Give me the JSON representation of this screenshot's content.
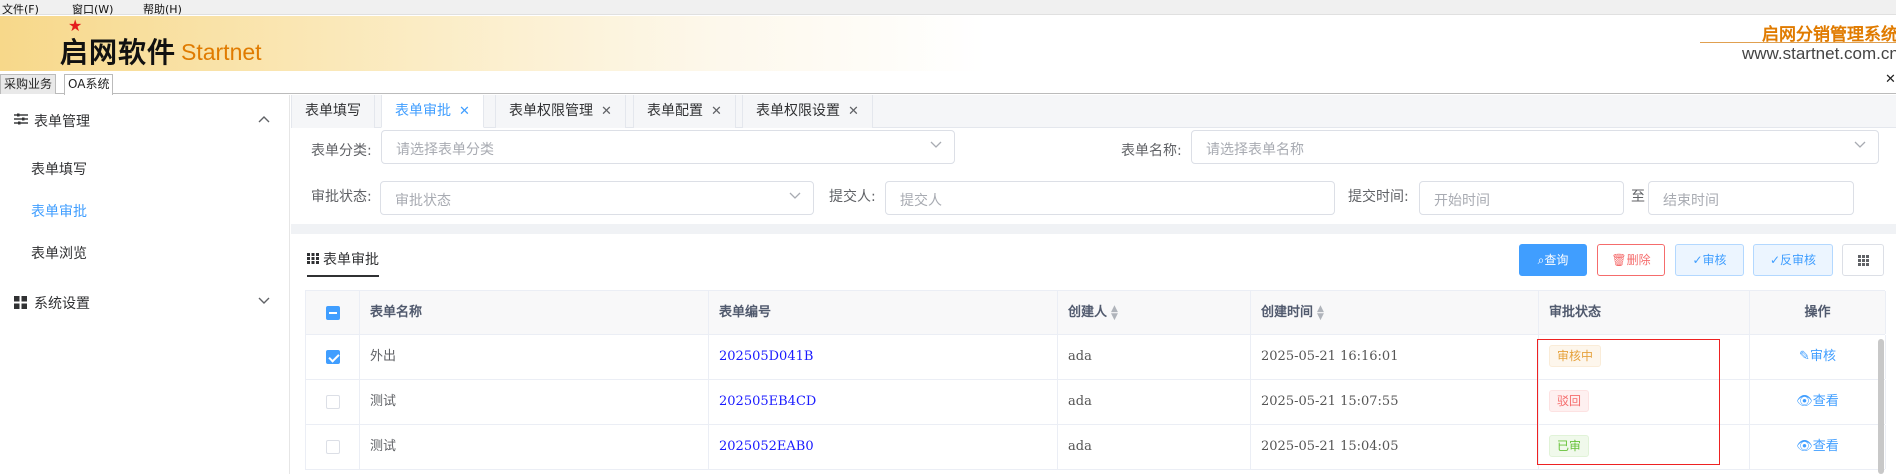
{
  "menu": [
    "文件(F)",
    "窗口(W)",
    "帮助(H)"
  ],
  "banner": {
    "logo_cn": "启网软件",
    "logo_en": "Startnet",
    "system_name": "启网分销管理系统",
    "website": "www.startnet.com.cn",
    "star_icon": "star-icon",
    "accent_color": "#e07b00"
  },
  "app_tabs": [
    "采购业务",
    "OA系统"
  ],
  "sidebar": {
    "groups": [
      {
        "label": "表单管理",
        "icon": "sliders-icon",
        "expanded": true
      },
      {
        "label": "系统设置",
        "icon": "grid-icon",
        "expanded": false
      }
    ],
    "items": [
      {
        "label": "表单填写",
        "active": false
      },
      {
        "label": "表单审批",
        "active": true
      },
      {
        "label": "表单浏览",
        "active": false
      }
    ]
  },
  "page_tabs": [
    {
      "label": "表单填写",
      "closable": false,
      "active": false
    },
    {
      "label": "表单审批",
      "closable": true,
      "active": true
    },
    {
      "label": "表单权限管理",
      "closable": true,
      "active": false
    },
    {
      "label": "表单配置",
      "closable": true,
      "active": false
    },
    {
      "label": "表单权限设置",
      "closable": true,
      "active": false
    }
  ],
  "filters": {
    "category_label": "表单分类:",
    "category_placeholder": "请选择表单分类",
    "name_label": "表单名称:",
    "name_placeholder": "请选择表单名称",
    "status_label": "审批状态:",
    "status_placeholder": "审批状态",
    "submitter_label": "提交人:",
    "submitter_placeholder": "提交人",
    "time_label": "提交时间:",
    "start_placeholder": "开始时间",
    "range_sep": "至",
    "end_placeholder": "结束时间"
  },
  "card": {
    "title": "表单审批",
    "buttons": {
      "query": "查询",
      "delete": "删除",
      "audit": "审核",
      "unaudit": "反审核"
    }
  },
  "table": {
    "columns": [
      "表单名称",
      "表单编号",
      "创建人",
      "创建时间",
      "审批状态",
      "操作"
    ],
    "rows": [
      {
        "checked": true,
        "name": "外出",
        "code": "202505D041B",
        "creator": "ada",
        "time": "2025-05-21 16:16:01",
        "status": "审核中",
        "status_type": "warn",
        "action": "审核",
        "action_icon": "edit-icon"
      },
      {
        "checked": false,
        "name": "测试",
        "code": "202505EB4CD",
        "creator": "ada",
        "time": "2025-05-21 15:07:55",
        "status": "驳回",
        "status_type": "danger",
        "action": "查看",
        "action_icon": "eye-icon"
      },
      {
        "checked": false,
        "name": "测试",
        "code": "2025052EAB0",
        "creator": "ada",
        "time": "2025-05-21 15:04:05",
        "status": "已审",
        "status_type": "success",
        "action": "查看",
        "action_icon": "eye-icon"
      }
    ]
  }
}
